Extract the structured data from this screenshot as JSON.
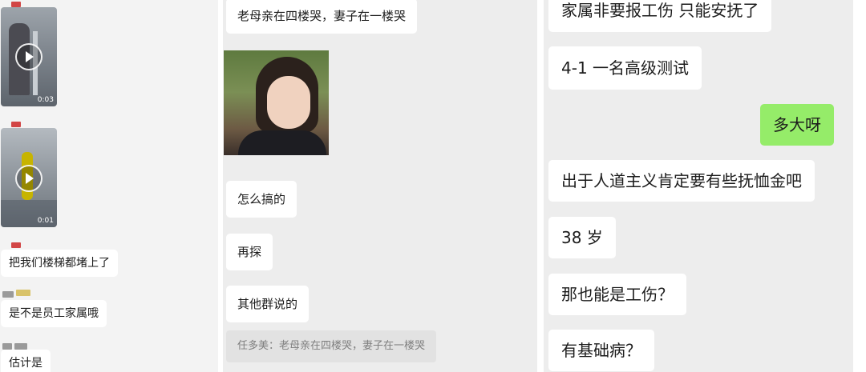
{
  "panel1": {
    "videos": [
      {
        "duration": "0:03"
      },
      {
        "duration": "0:01"
      }
    ],
    "messages": [
      {
        "text": "把我们楼梯都堵上了"
      },
      {
        "text": "是不是员工家属哦"
      },
      {
        "text": "估计是"
      }
    ]
  },
  "panel2": {
    "messages": [
      {
        "text": "老母亲在四楼哭，妻子在一楼哭"
      },
      {
        "text": "怎么搞的"
      },
      {
        "text": "再探"
      },
      {
        "text": "其他群说的"
      }
    ],
    "quote": "任多美：老母亲在四楼哭，妻子在一楼哭"
  },
  "panel3": {
    "messages": [
      {
        "text": "家属非要报工伤 只能安抚了"
      },
      {
        "text": "4-1  一名高级测试"
      },
      {
        "text": "多大呀"
      },
      {
        "text": "出于人道主义肯定要有些抚恤金吧"
      },
      {
        "text": "38 岁"
      },
      {
        "text": "那也能是工伤？"
      },
      {
        "text": "有基础病？"
      }
    ]
  },
  "colors": {
    "self_bubble": "#95ec69",
    "other_bubble": "#ffffff",
    "chat_bg": "#ededed"
  }
}
